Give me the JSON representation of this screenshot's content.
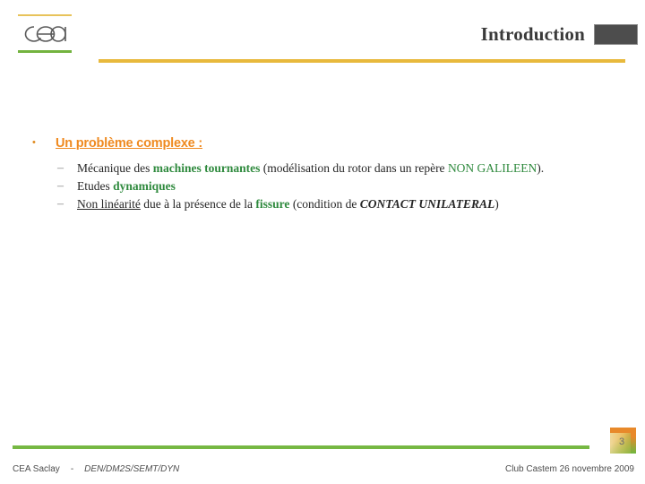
{
  "header": {
    "title": "Introduction",
    "logo_alt": "cea",
    "accent_yellow": "#e8b93c",
    "accent_green": "#73b33f",
    "title_box_color": "#4d4d4d"
  },
  "content": {
    "level1": {
      "bullet": "•",
      "text": "Un problème complexe :",
      "color": "#ef8a20"
    },
    "items": [
      {
        "dash": "–",
        "parts": [
          {
            "text": "Mécanique des ",
            "style": "normal"
          },
          {
            "text": "machines tournantes",
            "style": "green-bold"
          },
          {
            "text": " (modélisation du rotor dans un repère ",
            "style": "normal"
          },
          {
            "text": "NON GALILEEN",
            "style": "green"
          },
          {
            "text": ").",
            "style": "normal"
          }
        ]
      },
      {
        "dash": "–",
        "parts": [
          {
            "text": "Etudes ",
            "style": "normal"
          },
          {
            "text": "dynamiques",
            "style": "green-bold"
          }
        ]
      },
      {
        "dash": "–",
        "parts": [
          {
            "text": "Non linéarité",
            "style": "underline"
          },
          {
            "text": " due à la présence de la ",
            "style": "normal"
          },
          {
            "text": "fissure",
            "style": "green-bold"
          },
          {
            "text": " (condition de ",
            "style": "normal"
          },
          {
            "text": "CONTACT UNILATERAL",
            "style": "bold-italic"
          },
          {
            "text": ")",
            "style": "normal"
          }
        ]
      }
    ]
  },
  "footer": {
    "organisation": "CEA Saclay",
    "separator": "-",
    "department": "DEN/DM2S/SEMT/DYN",
    "event": "Club Castem 26 novembre 2009",
    "page_number": "3",
    "rule_color": "#76b843"
  }
}
